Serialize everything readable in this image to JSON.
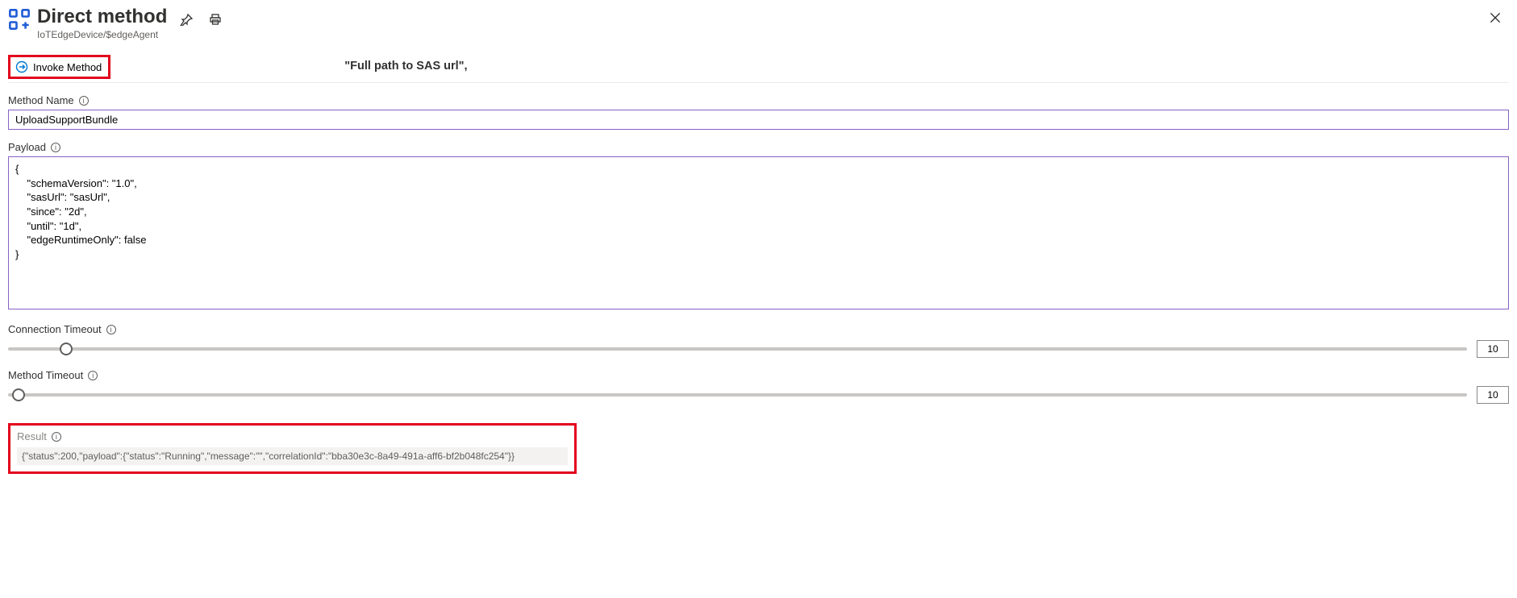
{
  "header": {
    "title": "Direct method",
    "breadcrumb": "IoTEdgeDevice/$edgeAgent"
  },
  "toolbar": {
    "invoke_label": "Invoke Method",
    "stray_text": "\"Full path to SAS url\","
  },
  "fields": {
    "method_name": {
      "label": "Method Name",
      "value": "UploadSupportBundle"
    },
    "payload": {
      "label": "Payload",
      "value": "{\n    \"schemaVersion\": \"1.0\",\n    \"sasUrl\": \"sasUrl\",\n    \"since\": \"2d\",\n    \"until\": \"1d\",\n    \"edgeRuntimeOnly\": false\n}"
    },
    "connection_timeout": {
      "label": "Connection Timeout",
      "value": "10"
    },
    "method_timeout": {
      "label": "Method Timeout",
      "value": "10"
    }
  },
  "result": {
    "label": "Result",
    "value": "{\"status\":200,\"payload\":{\"status\":\"Running\",\"message\":\"\",\"correlationId\":\"bba30e3c-8a49-491a-aff6-bf2b048fc254\"}}"
  }
}
